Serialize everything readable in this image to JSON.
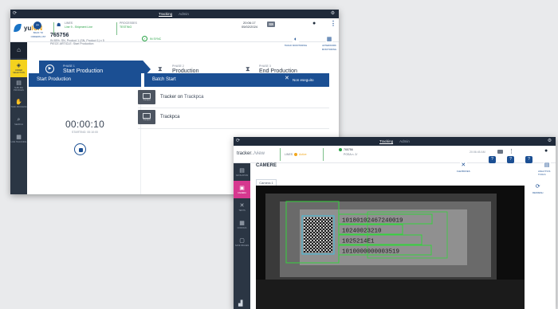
{
  "window1": {
    "topbar": {
      "tabs": [
        "Tracking",
        "Admin"
      ],
      "active_tab": 0
    },
    "header": {
      "logo_left": "yu",
      "logo_right": "ICN",
      "line1_label": "LINES",
      "line1_value": "Line 9 - Shipment Line",
      "line2_label": "PROCESSES",
      "line2_value": "TESTING",
      "time": "20:06:17",
      "date": "05/02/2024"
    },
    "sidebar": [
      {
        "icon": "◆",
        "label": "START JOBS",
        "active": false
      },
      {
        "icon": "⌂",
        "label": "",
        "active": false
      },
      {
        "icon": "◈",
        "label": "ORDER SELECTION",
        "active": true
      },
      {
        "icon": "▤",
        "label": "SUBLINE PROFILES",
        "active": false
      },
      {
        "icon": "✋",
        "label": "TASK PROCESS",
        "active": false
      },
      {
        "icon": "⌕",
        "label": "SEARCH",
        "active": false
      },
      {
        "icon": "▦",
        "label": "LIVE TRACKING",
        "active": false
      }
    ],
    "order": {
      "number": "765756",
      "desc_line1": "IN 85%: SN, Product 1 (SN, Product 1) x 5",
      "desc_line2": "PIECE ARTICLE: Start Production",
      "sync_label": "IN SYNC",
      "back_label": "BACK TO ORDERS LIST"
    },
    "right_tools": [
      {
        "icon": "◐",
        "label": "TRACK MONITORING"
      },
      {
        "icon": "▦",
        "label": "AFTERWORK MONITORING"
      }
    ],
    "phases": [
      {
        "small": "PHASE 1",
        "big": "Start Production"
      },
      {
        "small": "PHASE 2",
        "big": "Production"
      },
      {
        "small": "PHASE 3",
        "big": "End Production"
      }
    ],
    "start_bar": "Start Production",
    "batch_bar": "Batch Start",
    "batch_status": "Non eseguito",
    "link_label": "LINK",
    "timer": "00:00:10",
    "timer_sub": "STARTING: 00:10:00",
    "list": [
      {
        "thumb_label": "Trackpca",
        "text_main": "Tracker on ",
        "text_tail": "Trackpca"
      },
      {
        "thumb_label": "Trackpca",
        "text_main": "Trackpca",
        "text_tail": ""
      }
    ]
  },
  "window2": {
    "topbar": {
      "tabs": [
        "Tracking",
        "Admin"
      ],
      "active_tab": 0
    },
    "header": {
      "crumb_main": "tracker",
      "crumb_tail": "../view",
      "status_a": "LINES",
      "status_b": "Active",
      "order_label": "765756",
      "order_sub": "POSA n. 2/",
      "time": "20:06:45 AM"
    },
    "sidebar": [
      {
        "icon": "▤",
        "label": "NAVIGATION",
        "active": false
      },
      {
        "icon": "▣",
        "label": "CAMERA",
        "active": true
      },
      {
        "icon": "✕",
        "label": "TESTS",
        "active": false
      },
      {
        "icon": "▦",
        "label": "CONFIGS",
        "active": false
      },
      {
        "icon": "▢",
        "label": "SAVE IMAGES",
        "active": false
      }
    ],
    "section_title": "CAMERE",
    "tools": [
      {
        "icon": "✕",
        "label": "FLEXBOXES"
      },
      {
        "icon": "?",
        "label": ""
      },
      {
        "icon": "?",
        "label": ""
      },
      {
        "icon": "?",
        "label": ""
      },
      {
        "icon": "▤",
        "label": "ANALYTICS TOOLS"
      }
    ],
    "refresh_label": "REFRESH",
    "camera_tab": "Camera 1",
    "barcode_rows": [
      "10180102467240019",
      "10240023210",
      "1025214E1",
      "1010000000003519"
    ]
  }
}
